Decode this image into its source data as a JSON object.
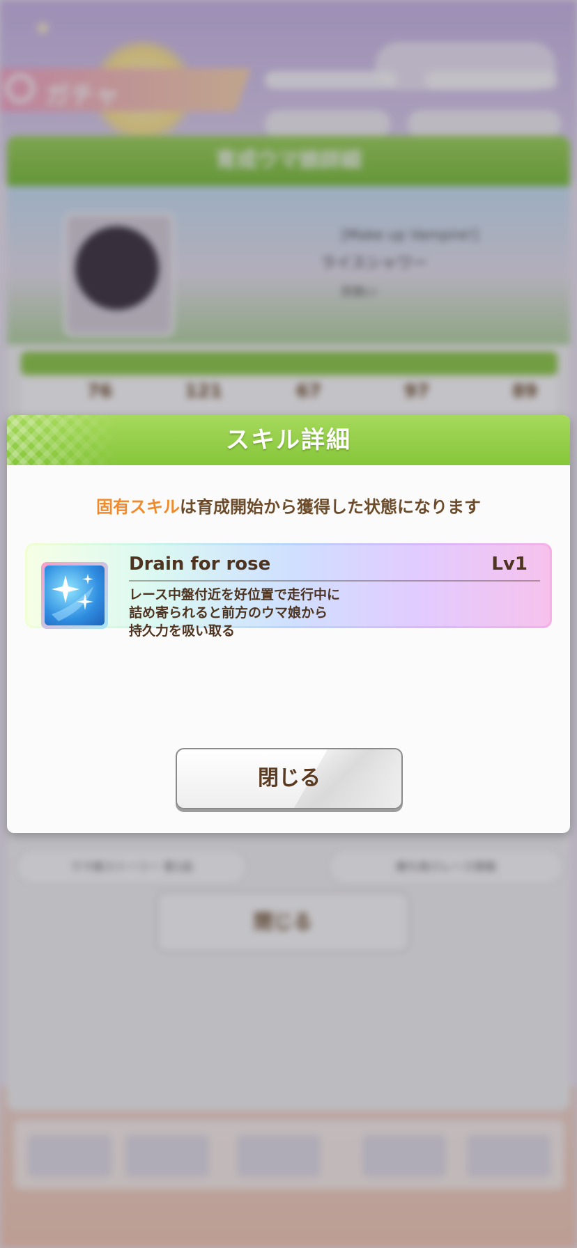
{
  "background": {
    "screen_label": "ガチャ",
    "panel_title": "育成ウマ娘詳細",
    "chara_title": "[Make up Vampire!]",
    "chara_name": "ライスシャワー",
    "chara_sub": "距離Lv",
    "stats": [
      "76",
      "121",
      "67",
      "97",
      "89"
    ],
    "lower_buttons": [
      "ウマ娘ストーリー 第1話",
      "勝ち負けレース情報"
    ],
    "lower_close": "閉じる"
  },
  "modal": {
    "title": "スキル詳細",
    "notice_highlight": "固有スキル",
    "notice_rest": "は育成開始から獲得した状態になります",
    "skill": {
      "icon": "sparkle-icon",
      "name": "Drain for rose",
      "level": "Lv1",
      "description": [
        "レース中盤付近を好位置で走行中に",
        "詰め寄られると前方のウマ娘から",
        "持久力を吸い取る"
      ]
    },
    "close_label": "閉じる"
  },
  "colors": {
    "header_green": "#86c63a",
    "highlight_orange": "#f08a2c",
    "text_brown": "#5a3b22"
  }
}
